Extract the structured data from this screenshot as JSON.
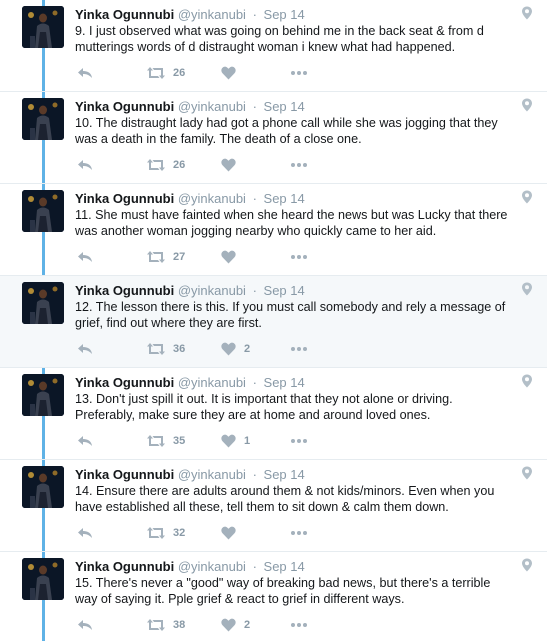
{
  "colors": {
    "thread_line": "#5fb2e6",
    "icon_gray": "#a4b1bc",
    "name": "#14171a",
    "meta": "#8899a6",
    "highlight_bg": "#f5f8fa"
  },
  "icons": {
    "reply": "reply-icon",
    "retweet": "retweet-icon",
    "like": "heart-icon",
    "more": "more-dots-icon",
    "location": "location-pin-icon"
  },
  "tweets": [
    {
      "name": "Yinka Ogunnubi",
      "handle": "@yinkanubi",
      "sep": "·",
      "date": "Sep 14",
      "text": "9. I just observed what was going on behind me in the back seat & from d mutterings words of d distraught woman i knew what had happened.",
      "retweets": "26",
      "likes": ""
    },
    {
      "name": "Yinka Ogunnubi",
      "handle": "@yinkanubi",
      "sep": "·",
      "date": "Sep 14",
      "text": "10. The distraught lady had got a phone call while she was jogging that they was a death in the family. The death of a close one.",
      "retweets": "26",
      "likes": ""
    },
    {
      "name": "Yinka Ogunnubi",
      "handle": "@yinkanubi",
      "sep": "·",
      "date": "Sep 14",
      "text": "11. She must have fainted when she heard the news but was Lucky that there was another woman jogging nearby who quickly came to her aid.",
      "retweets": "27",
      "likes": ""
    },
    {
      "name": "Yinka Ogunnubi",
      "handle": "@yinkanubi",
      "sep": "·",
      "date": "Sep 14",
      "text": "12. The lesson there is this. If you must call somebody and rely a message of grief, find out where they are first.",
      "retweets": "36",
      "likes": "2"
    },
    {
      "name": "Yinka Ogunnubi",
      "handle": "@yinkanubi",
      "sep": "·",
      "date": "Sep 14",
      "text": "13. Don't just spill it out. It is important that they not alone or driving. Preferably, make sure they are at home and around loved ones.",
      "retweets": "35",
      "likes": "1"
    },
    {
      "name": "Yinka Ogunnubi",
      "handle": "@yinkanubi",
      "sep": "·",
      "date": "Sep 14",
      "text": "14. Ensure there are adults around them & not kids/minors. Even when you have established all these, tell them to sit down & calm them down.",
      "retweets": "32",
      "likes": ""
    },
    {
      "name": "Yinka Ogunnubi",
      "handle": "@yinkanubi",
      "sep": "·",
      "date": "Sep 14",
      "text": "15. There's never a \"good\" way of breaking bad news, but there's a terrible way of saying it. Pple grief & react to grief in different ways.",
      "retweets": "38",
      "likes": "2"
    }
  ]
}
